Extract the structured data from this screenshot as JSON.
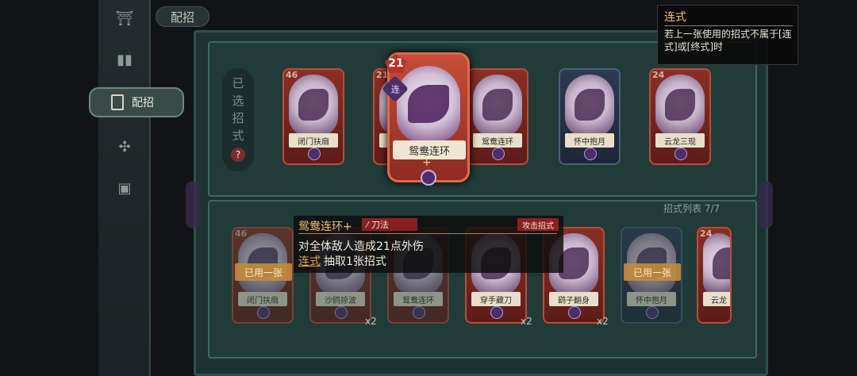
{
  "header": {
    "title": "配招"
  },
  "sidebar": {
    "items": [
      {
        "icon": "pagoda-icon",
        "glyph": "⛩"
      },
      {
        "icon": "cards-icon",
        "glyph": "▮▮"
      },
      {
        "icon": "card-deck-icon",
        "label": "配招",
        "active": true
      },
      {
        "icon": "emblem-icon",
        "glyph": "✣"
      },
      {
        "icon": "scroll-icon",
        "glyph": "▣"
      }
    ]
  },
  "selected": {
    "label": [
      "已",
      "选",
      "招",
      "式"
    ],
    "help": "?"
  },
  "selected_cards": [
    {
      "name": "闭门扶扇",
      "cost": "46"
    },
    {
      "name": "",
      "cost": "21"
    },
    {
      "name": "鸳鸯连环",
      "cost": ""
    },
    {
      "name": "怀中抱月",
      "cost": ""
    },
    {
      "name": "云龙三现",
      "cost": "24"
    }
  ],
  "highlight_card": {
    "name": "鸳鸯连环",
    "cost": "21",
    "chain_badge": "连",
    "plus": "+"
  },
  "list_header": "招式列表 7/7",
  "list_cards": [
    {
      "name": "闭门扶扇",
      "cost": "46",
      "badge": "已用一张",
      "mult": ""
    },
    {
      "name": "沙鸥掠波",
      "cost": "",
      "badge": "",
      "mult": "x2"
    },
    {
      "name": "鸳鸯连环",
      "cost": "",
      "badge": "",
      "mult": ""
    },
    {
      "name": "穿手藏刀",
      "cost": "",
      "badge": "",
      "mult": "x2"
    },
    {
      "name": "鹞子翻身",
      "cost": "",
      "badge": "",
      "mult": "x2"
    },
    {
      "name": "怀中抱月",
      "cost": "",
      "badge": "已用一张",
      "mult": ""
    },
    {
      "name": "云龙",
      "cost": "24",
      "badge": "",
      "mult": ""
    }
  ],
  "tooltip": {
    "title": "鸳鸯连环+",
    "tag": "刀法",
    "type": "攻击招式",
    "description": "对全体敌人造成21点外伤",
    "keyword": "连式",
    "effect": "抽取1张招式"
  },
  "keyword_popup": {
    "title": "连式",
    "description": "若上一张使用的招式不属于[连式]或[终式]时"
  }
}
